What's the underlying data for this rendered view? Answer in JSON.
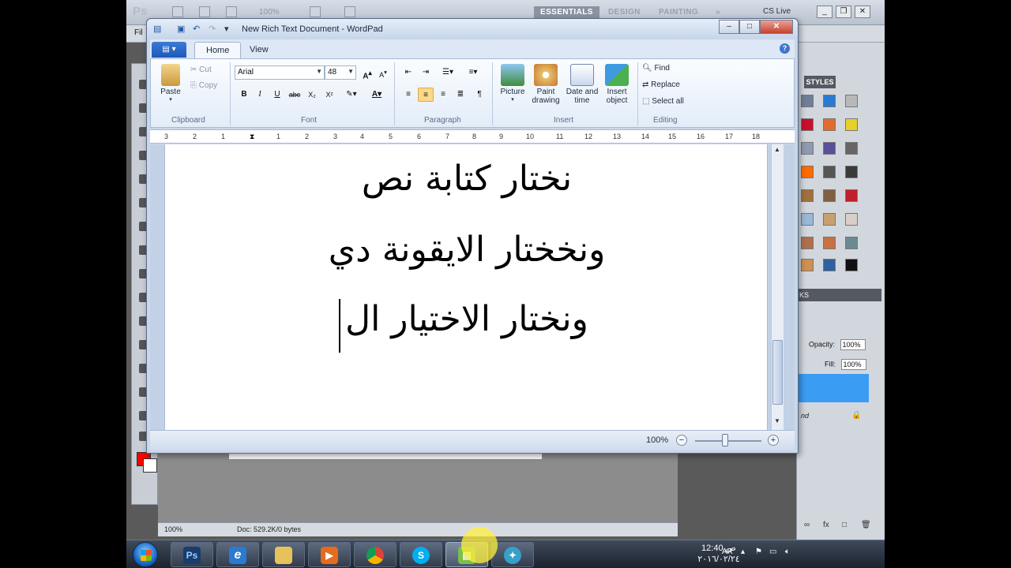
{
  "photoshop": {
    "logo": "Ps",
    "zoom": "100%",
    "workspaces": [
      "ESSENTIALS",
      "DESIGN",
      "PAINTING"
    ],
    "more_icon": "double-chevron-right-icon",
    "cs_live": "CS Live",
    "menu_fragment": "Fil",
    "styles_tab": "STYLES",
    "layers_tab_fragment": "KS",
    "opacity_label": "Opacity:",
    "opacity_value": "100%",
    "fill_label": "Fill:",
    "fill_value": "100%",
    "layer_name_fragment": "nd",
    "status_zoom": "100%",
    "status_doc": "Doc: 529.2K/0 bytes",
    "foreground_color": "#ff0000",
    "background_color": "#ffffff"
  },
  "wordpad": {
    "title": "New Rich Text Document - WordPad",
    "tabs": [
      "Home",
      "View"
    ],
    "clipboard": {
      "paste": "Paste",
      "cut": "Cut",
      "copy": "Copy",
      "label": "Clipboard"
    },
    "font": {
      "family": "Arial",
      "size": "48",
      "label": "Font"
    },
    "paragraph": {
      "label": "Paragraph"
    },
    "insert": {
      "picture": "Picture",
      "paint_drawing_1": "Paint",
      "paint_drawing_2": "drawing",
      "date_time_1": "Date and",
      "date_time_2": "time",
      "insert_object_1": "Insert",
      "insert_object_2": "object",
      "label": "Insert"
    },
    "editing": {
      "find": "Find",
      "replace": "Replace",
      "select_all": "Select all",
      "label": "Editing"
    },
    "ruler": [
      "3",
      "2",
      "1",
      "1",
      "2",
      "3",
      "4",
      "5",
      "6",
      "7",
      "8",
      "9",
      "10",
      "11",
      "12",
      "13",
      "14",
      "15",
      "16",
      "17",
      "18"
    ],
    "document_lines": [
      "نختار كتابة نص",
      "ونخختار الايقونة دي",
      "ونختار الاختيار ال"
    ],
    "zoom": "100%"
  },
  "taskbar": {
    "apps": [
      "Ps",
      "e",
      "folder",
      "media",
      "chrome",
      "S",
      "wordpad",
      "movie"
    ],
    "language": "AR",
    "time": "12:40 ص",
    "date": "٢٠١٦/٠٢/٢٤"
  }
}
